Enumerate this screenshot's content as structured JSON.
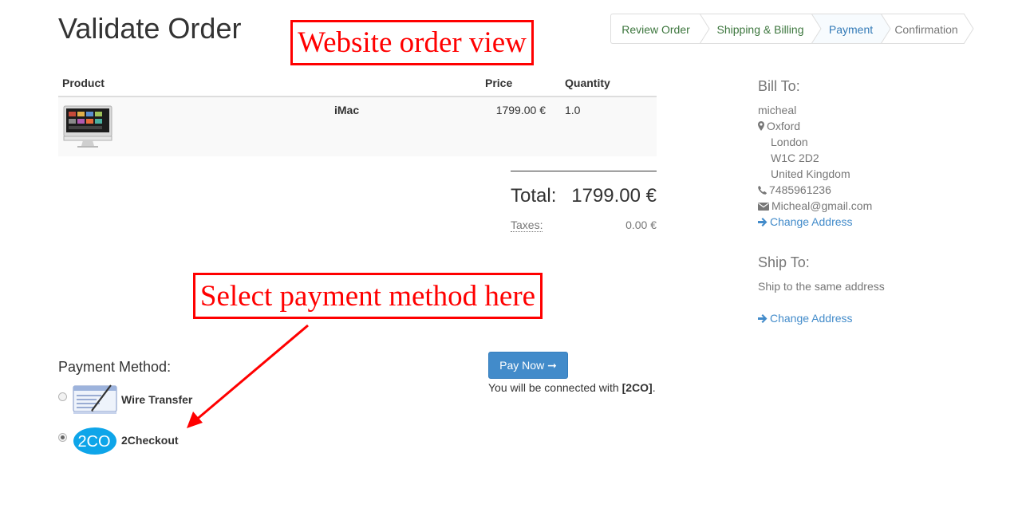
{
  "page": {
    "title": "Validate Order"
  },
  "wizard": {
    "steps": [
      {
        "label": "Review Order",
        "state": "done"
      },
      {
        "label": "Shipping & Billing",
        "state": "done"
      },
      {
        "label": "Payment",
        "state": "active"
      },
      {
        "label": "Confirmation",
        "state": "todo"
      }
    ]
  },
  "annotations": {
    "order_view": "Website order view",
    "select_payment": "Select payment method here"
  },
  "order": {
    "headers": {
      "product": "Product",
      "price": "Price",
      "quantity": "Quantity"
    },
    "lines": [
      {
        "name": "iMac",
        "price": "1799.00 €",
        "quantity": "1.0",
        "image_icon": "imac-thumbnail"
      }
    ],
    "total_label": "Total:",
    "total_value": "1799.00 €",
    "taxes_label": "Taxes:",
    "taxes_value": "0.00 €"
  },
  "payment": {
    "heading": "Payment Method:",
    "methods": [
      {
        "name": "Wire Transfer",
        "icon": "wire-transfer-icon",
        "selected": false
      },
      {
        "name": "2Checkout",
        "icon": "2checkout-logo",
        "logo_text": "2CO",
        "selected": true
      }
    ],
    "pay_button": "Pay Now ➞",
    "connect_prefix": "You will be connected with ",
    "connect_provider": "[2CO]",
    "connect_suffix": "."
  },
  "bill_to": {
    "heading": "Bill To:",
    "name": "micheal",
    "city": "Oxford",
    "line2": "London",
    "postcode": "W1C 2D2",
    "country": "United Kingdom",
    "phone": "7485961236",
    "email": "Micheal@gmail.com",
    "change_link": "Change Address"
  },
  "ship_to": {
    "heading": "Ship To:",
    "text": "Ship to the same address",
    "change_link": "Change Address"
  },
  "colors": {
    "done": "#3c763d",
    "active": "#337ab7",
    "link": "#428bca",
    "annotation": "#ff0000",
    "button": "#428bca"
  }
}
